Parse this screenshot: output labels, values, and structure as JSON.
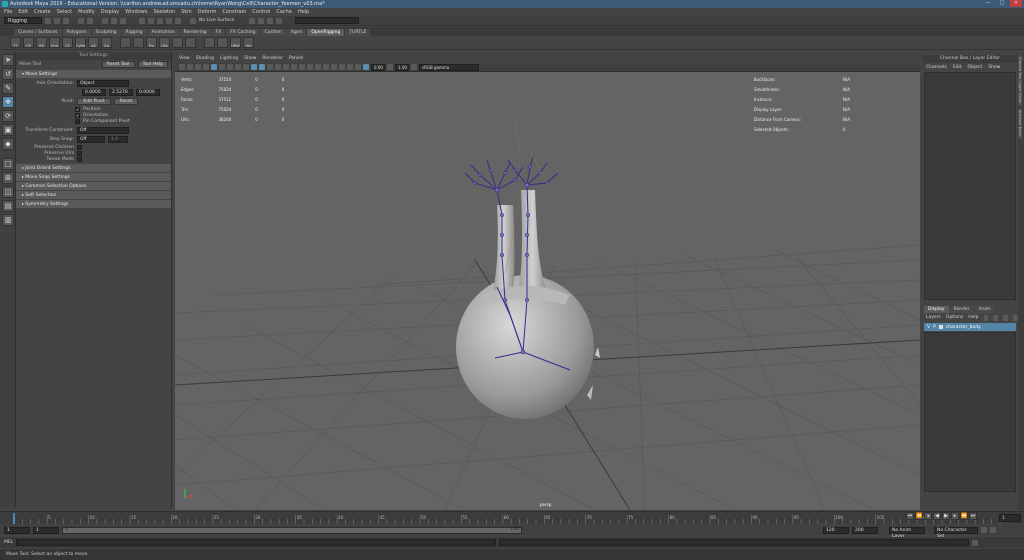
{
  "window": {
    "title": "Autodesk Maya 2016 - Educational Version: \\\\carlton.andrew.ad.smcadu.ch\\home\\RyanWong\\Cell\\Character_Yeemen_v03.ma*",
    "min": "—",
    "max": "□",
    "close": "✕"
  },
  "menubar": [
    "File",
    "Edit",
    "Create",
    "Select",
    "Modify",
    "Display",
    "Windows",
    "Skeleton",
    "Skin",
    "Deform",
    "Constrain",
    "Control",
    "Cache",
    "Help"
  ],
  "status_line": {
    "mode": "Rigging",
    "live_surface": "No Live Surface"
  },
  "shelf_tabs": [
    {
      "label": "Curves / Surfaces",
      "active": false
    },
    {
      "label": "Polygons",
      "active": false
    },
    {
      "label": "Sculpting",
      "active": false
    },
    {
      "label": "Rigging",
      "active": false
    },
    {
      "label": "Animation",
      "active": false
    },
    {
      "label": "Rendering",
      "active": false
    },
    {
      "label": "FX",
      "active": false
    },
    {
      "label": "FX Caching",
      "active": false
    },
    {
      "label": "Custom",
      "active": false
    },
    {
      "label": "Xgen",
      "active": false
    },
    {
      "label": "OpenRigging",
      "active": true
    },
    {
      "label": "TURTLE",
      "active": false
    }
  ],
  "shelf_buttons": [
    "FT",
    "CP",
    "RS",
    "Ornt",
    "CS",
    "CyRd",
    "AS",
    "SA",
    "",
    "",
    "Prx",
    "LRA",
    "",
    "",
    "",
    "",
    "HRW",
    "Vm"
  ],
  "tool_settings": {
    "header": "Tool Settings",
    "tool_name": "Move Tool",
    "reset_tool": "Reset Tool",
    "tool_help": "Tool Help",
    "sections": {
      "move_settings": "Move Settings",
      "joint_orient": "Joint Orient Settings",
      "move_snap": "Move Snap Settings",
      "common_selection": "Common Selection Options",
      "soft_selection": "Soft Selection",
      "symmetry": "Symmetry Settings"
    },
    "axis_orientation_label": "Axis Orientation:",
    "axis_orientation_value": "Object",
    "values": [
      "0.0000",
      "2.5270",
      "0.0000"
    ],
    "pivot_label": "Pivot:",
    "edit_pivot": "Edit Pivot",
    "reset": "Reset",
    "position": "Position",
    "orientation": "Orientation",
    "pin_component_pivot": "Pin Component Pivot",
    "transform_constraint_label": "Transform Constraint:",
    "transform_constraint_value": "Off",
    "step_snap_label": "Step Snap:",
    "step_snap_value": "Off",
    "step_value": "1.0",
    "preserve_children": "Preserve Children",
    "preserve_uvs": "Preserve UVs",
    "tweak_mode": "Tweak Mode"
  },
  "viewport": {
    "menu": [
      "View",
      "Shading",
      "Lighting",
      "Show",
      "Renderer",
      "Panels"
    ],
    "exposure": "0.00",
    "gamma": "1.00",
    "color_space": "sRGB gamma",
    "hud_left": [
      {
        "label": "Verts:",
        "a": "37514",
        "b": "0",
        "c": "0"
      },
      {
        "label": "Edges:",
        "a": "75024",
        "b": "0",
        "c": "0"
      },
      {
        "label": "Faces:",
        "a": "37512",
        "b": "0",
        "c": "0"
      },
      {
        "label": "Tris:",
        "a": "75024",
        "b": "0",
        "c": "0"
      },
      {
        "label": "UVs:",
        "a": "38160",
        "b": "0",
        "c": "0"
      }
    ],
    "hud_right": [
      {
        "label": "Backfaces:",
        "value": "N/A"
      },
      {
        "label": "Smoothness:",
        "value": "N/A"
      },
      {
        "label": "Instance:",
        "value": "N/A"
      },
      {
        "label": "Display Layer:",
        "value": "N/A"
      },
      {
        "label": "Distance From Camera:",
        "value": "N/A"
      },
      {
        "label": "Selected Objects:",
        "value": "0"
      }
    ],
    "camera": "persp"
  },
  "channel_box": {
    "title": "Channel Box / Layer Editor",
    "menu": [
      "Channels",
      "Edit",
      "Object",
      "Show"
    ]
  },
  "layer_editor": {
    "tabs": [
      "Display",
      "Render",
      "Anim"
    ],
    "menu": [
      "Layers",
      "Options",
      "Help"
    ],
    "layer": {
      "v": "V",
      "p": "P",
      "name": "character_body"
    }
  },
  "side_tabs": [
    "Channel Box / Layer Editor",
    "Attribute Editor"
  ],
  "timeline": {
    "ticks": [
      "5",
      "10",
      "15",
      "20",
      "25",
      "30",
      "35",
      "40",
      "45",
      "50",
      "55",
      "60",
      "65",
      "70",
      "75",
      "80",
      "85",
      "90",
      "95",
      "100",
      "105",
      "110",
      "115",
      "120"
    ],
    "current": "1",
    "range_start": "1",
    "range_inner_start": "1",
    "range_inner_end": "120",
    "range_end_a": "120",
    "range_end_b": "200",
    "anim_layer": "No Anim Layer",
    "character_set": "No Character Set"
  },
  "mel_label": "MEL",
  "help_line": "Move Tool: Select an object to move."
}
